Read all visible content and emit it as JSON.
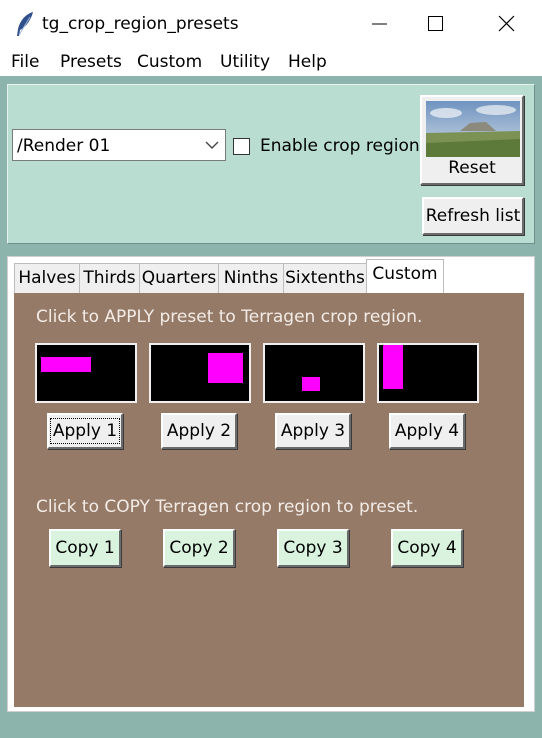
{
  "window": {
    "title": "tg_crop_region_presets"
  },
  "menu": {
    "items": [
      "File",
      "Presets",
      "Custom",
      "Utility",
      "Help"
    ]
  },
  "controls": {
    "render_value": "/Render 01",
    "enable_crop_label": "Enable crop region",
    "enable_crop_checked": false,
    "reset_label": "Reset",
    "refresh_label": "Refresh list"
  },
  "tabs": {
    "labels": [
      "Halves",
      "Thirds",
      "Quarters",
      "Ninths",
      "Sixtenths",
      "Custom"
    ],
    "active": "Custom"
  },
  "custom_tab": {
    "apply_caption": "Click to APPLY preset to Terragen crop region.",
    "copy_caption": "Click to COPY Terragen crop region to preset.",
    "apply_buttons": [
      "Apply 1",
      "Apply 2",
      "Apply 3",
      "Apply 4"
    ],
    "copy_buttons": [
      "Copy 1",
      "Copy 2",
      "Copy 3",
      "Copy 4"
    ],
    "preset_color": "#ff00ff"
  },
  "colors": {
    "frame": "#8cb3ac",
    "top_panel": "#b9ddd1",
    "tab_content": "#967a68",
    "copy_button": "#d9f3de"
  }
}
